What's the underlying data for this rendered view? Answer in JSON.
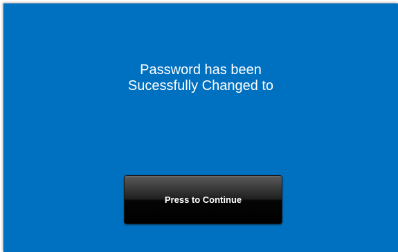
{
  "screen": {
    "background_color": "#0070c0",
    "message": {
      "line1": "Password has been",
      "line2": "Sucessfully Changed to"
    },
    "continue_button": {
      "label": "Press to Continue"
    }
  }
}
